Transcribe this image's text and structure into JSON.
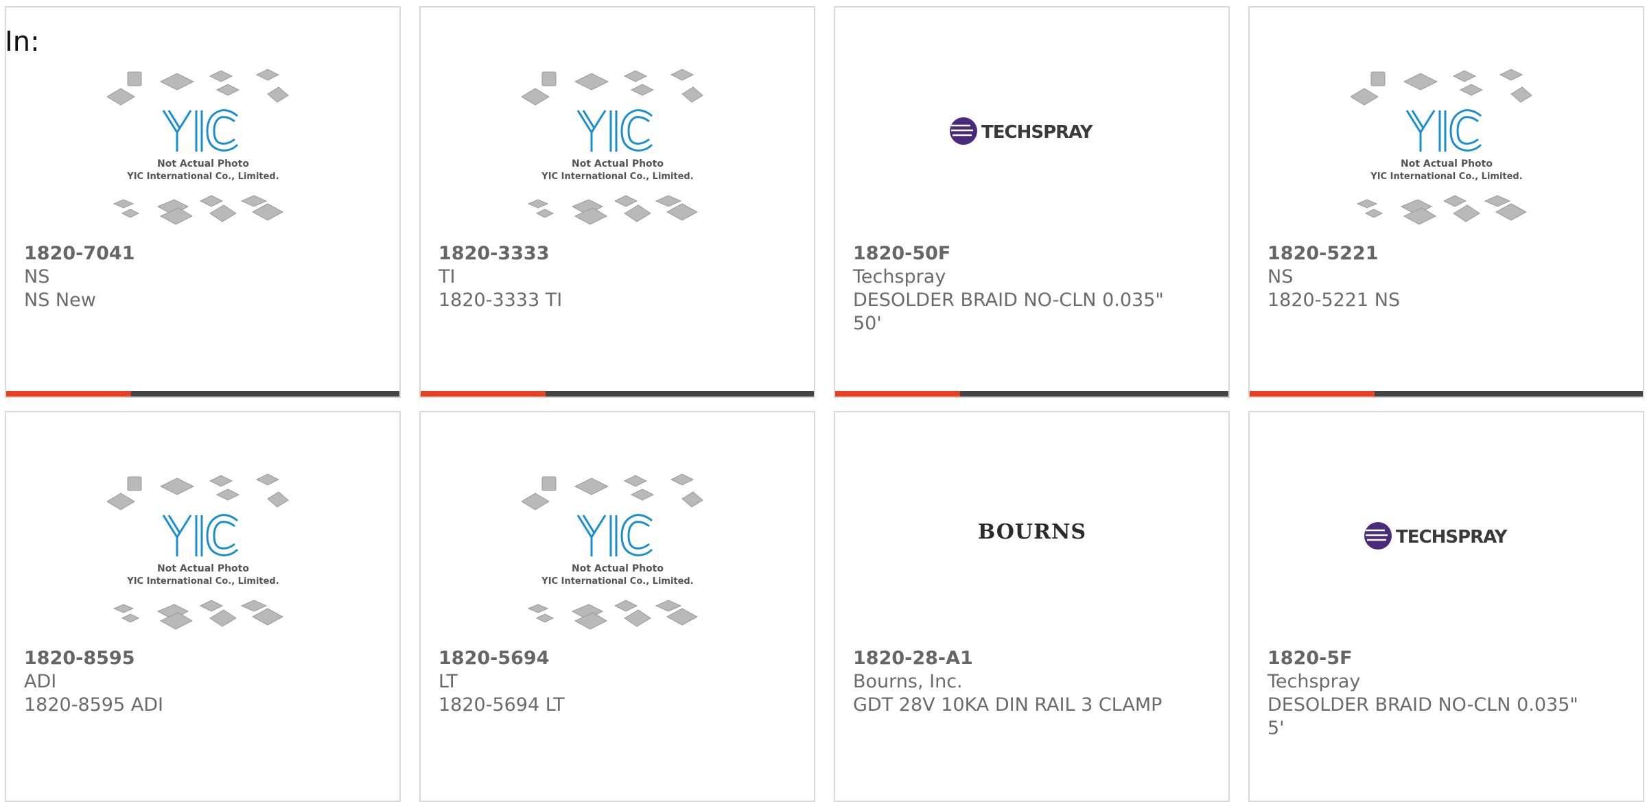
{
  "header": {
    "label": "In:"
  },
  "colors": {
    "accent": "#e8411e",
    "bar": "#444444",
    "yic_blue": "#1a8fd0",
    "techspray_purple": "#4a2a7a"
  },
  "placeholder_image": {
    "line1": "Not Actual Photo",
    "line2": "YIC International Co., Limited."
  },
  "products": [
    {
      "part": "1820-7041",
      "manufacturer": "NS",
      "description": "NS New",
      "image": "yic-placeholder"
    },
    {
      "part": "1820-3333",
      "manufacturer": "TI",
      "description": "1820-3333 TI",
      "image": "yic-placeholder"
    },
    {
      "part": "1820-50F",
      "manufacturer": "Techspray",
      "description": "DESOLDER BRAID NO-CLN 0.035\" 50'",
      "image": "techspray-logo"
    },
    {
      "part": "1820-5221",
      "manufacturer": "NS",
      "description": "1820-5221 NS",
      "image": "yic-placeholder"
    },
    {
      "part": "1820-8595",
      "manufacturer": "ADI",
      "description": "1820-8595 ADI",
      "image": "yic-placeholder"
    },
    {
      "part": "1820-5694",
      "manufacturer": "LT",
      "description": "1820-5694 LT",
      "image": "yic-placeholder"
    },
    {
      "part": "1820-28-A1",
      "manufacturer": "Bourns, Inc.",
      "description": "GDT 28V 10KA DIN RAIL 3 CLAMP",
      "image": "bourns-logo"
    },
    {
      "part": "1820-5F",
      "manufacturer": "Techspray",
      "description": "DESOLDER BRAID NO-CLN 0.035\" 5'",
      "image": "techspray-logo"
    }
  ],
  "logos": {
    "techspray": "TECHSPRAY",
    "bourns": "BOURNS"
  }
}
